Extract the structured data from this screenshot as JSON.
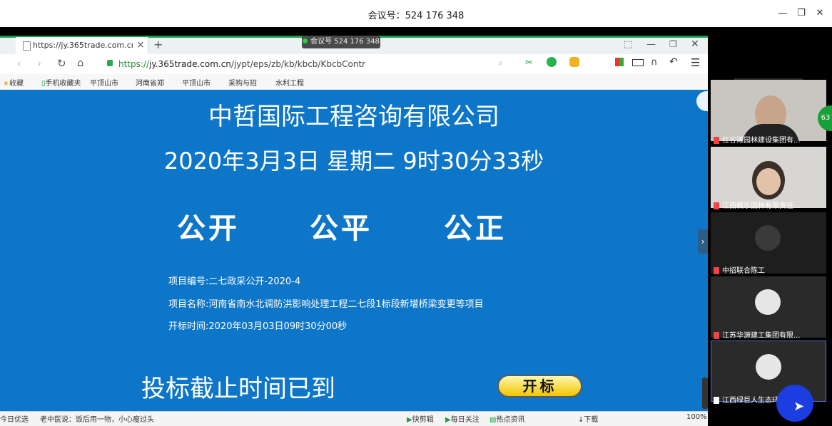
{
  "meeting": {
    "title": "会议号：524 176 348",
    "badge": "会议号 524 176 348",
    "minimize": "—",
    "restore": "❐",
    "close": "✕"
  },
  "browser": {
    "tab_title": "https://jy.365trade.com.cn/jyp",
    "tab_close": "×",
    "new_tab": "+",
    "url_prefix": "https://",
    "url_domain": "jy.365trade.com.cn",
    "url_path": "/jypt/eps/zb/kb/kbcb/KbcbContr",
    "bookmarks": [
      "收藏",
      "手机收藏夹",
      "平顶山市",
      "河南省郑",
      "平顶山市",
      "采购与招",
      "水利工程"
    ]
  },
  "page": {
    "company": "中哲国际工程咨询有限公司",
    "datetime": "2020年3月3日  星期二  9时30分33秒",
    "slogans": [
      "公开",
      "公平",
      "公正"
    ],
    "project_no": "项目编号:二七政采公开-2020-4",
    "project_name": "项目名称:河南省南水北调防洪影响处理工程二七段1标段新增桥梁变更等项目",
    "open_time": "开标时间:2020年03月03日09时30分00秒",
    "deadline": "投标截止时间已到",
    "open_button": "开标"
  },
  "statusbar": {
    "left1": "今日优选",
    "left2": "老中医说：饭后用一物，小心瘦过头",
    "items": [
      "快剪辑",
      "每日关注",
      "热点资讯",
      "下载",
      "100%"
    ]
  },
  "participants": [
    {
      "name": "红谷滩园林建设集团有..."
    },
    {
      "name": "江西楓乐园林有限责任..."
    },
    {
      "name": "中招联合陈工"
    },
    {
      "name": "江苏华源建工集团有限..."
    },
    {
      "name": "江西绿巨人生态环境股..."
    }
  ],
  "panel": {
    "badge": "63"
  },
  "colors": {
    "page_bg": "#0e76c8",
    "accent_green": "#19a04a"
  }
}
